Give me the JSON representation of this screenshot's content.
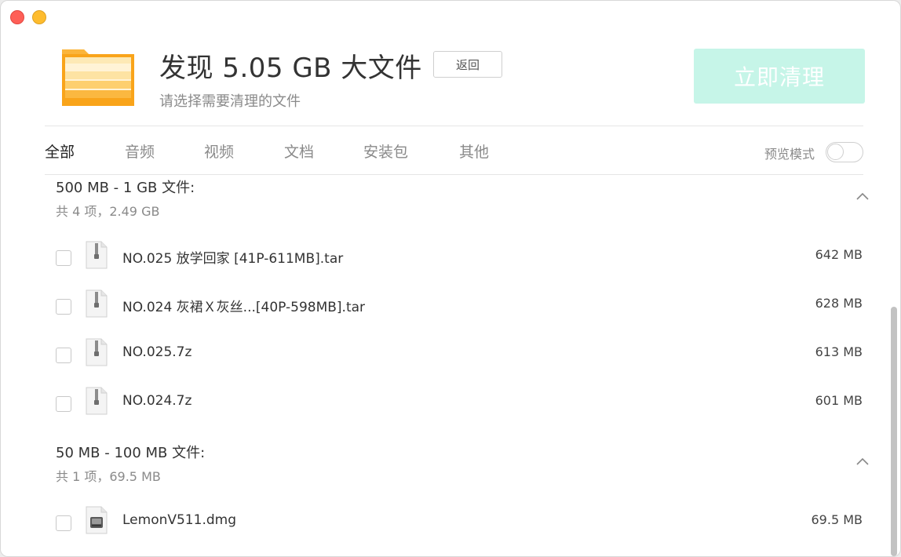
{
  "window": {
    "traffic_lights": [
      "close",
      "minimize"
    ]
  },
  "header": {
    "title": "发现 5.05 GB 大文件",
    "subtitle": "请选择需要清理的文件",
    "back_label": "返回",
    "clean_label": "立即清理",
    "folder_icon": "folder-icon"
  },
  "tabs": [
    {
      "label": "全部",
      "active": true
    },
    {
      "label": "音频",
      "active": false
    },
    {
      "label": "视频",
      "active": false
    },
    {
      "label": "文档",
      "active": false
    },
    {
      "label": "安装包",
      "active": false
    },
    {
      "label": "其他",
      "active": false
    }
  ],
  "preview_mode": {
    "label": "预览模式",
    "enabled": false
  },
  "groups": [
    {
      "title": "500 MB - 1 GB 文件:",
      "summary": "共 4 项，2.49 GB",
      "expanded": true,
      "files": [
        {
          "name": "NO.025 放学回家 [41P-611MB].tar",
          "size": "642 MB",
          "icon": "archive-file-icon",
          "checked": false
        },
        {
          "name": "NO.024 灰裙Ｘ灰丝...[40P-598MB].tar",
          "size": "628 MB",
          "icon": "archive-file-icon",
          "checked": false
        },
        {
          "name": "NO.025.7z",
          "size": "613 MB",
          "icon": "archive-file-icon",
          "checked": false
        },
        {
          "name": "NO.024.7z",
          "size": "601 MB",
          "icon": "archive-file-icon",
          "checked": false
        }
      ]
    },
    {
      "title": "50 MB - 100 MB 文件:",
      "summary": "共 1 项，69.5 MB",
      "expanded": true,
      "files": [
        {
          "name": "LemonV511.dmg",
          "size": "69.5 MB",
          "icon": "disk-image-file-icon",
          "checked": false
        }
      ]
    }
  ],
  "colors": {
    "accent_disabled": "#c6f5e8",
    "close": "#fe5f57",
    "minimize": "#febc2e",
    "folder": "#f9a41a"
  }
}
